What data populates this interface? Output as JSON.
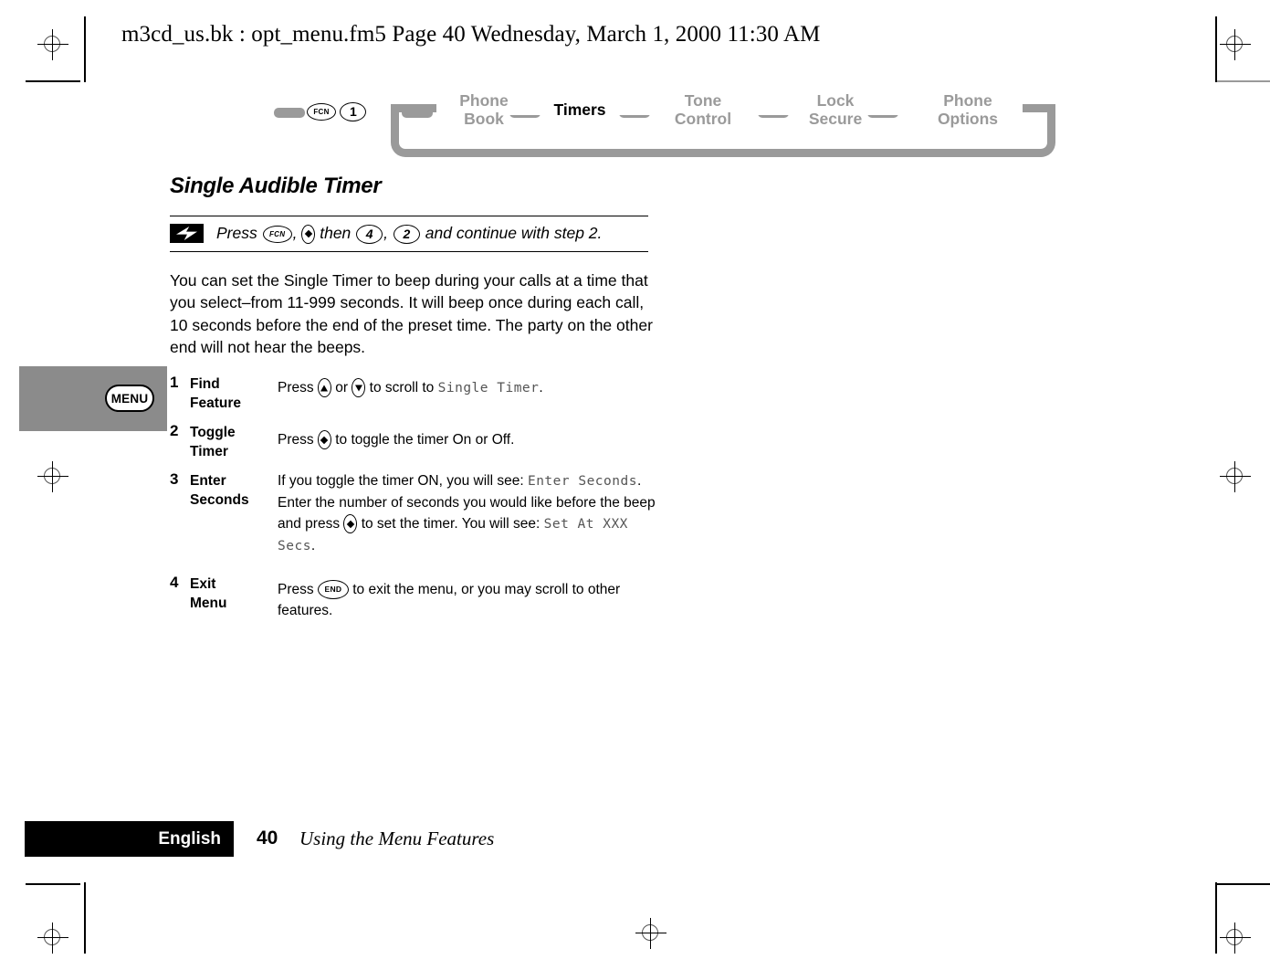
{
  "page_header": "m3cd_us.bk : opt_menu.fm5  Page 40  Wednesday, March 1, 2000  11:30 AM",
  "side_tab": {
    "label": "MENU"
  },
  "nav": {
    "keys": [
      {
        "name": "fcn-key",
        "label": "FCN"
      },
      {
        "name": "one-key",
        "label": "1"
      }
    ],
    "items": [
      {
        "line1": "Phone",
        "line2": "Book",
        "active": false
      },
      {
        "line1": "Timers",
        "line2": "",
        "active": true
      },
      {
        "line1": "Tone",
        "line2": "Control",
        "active": false
      },
      {
        "line1": "Lock",
        "line2": "Secure",
        "active": false
      },
      {
        "line1": "Phone",
        "line2": "Options",
        "active": false
      }
    ]
  },
  "section": {
    "title": "Single Audible Timer",
    "callout": {
      "press_word": "Press",
      "fcn_label": "FCN",
      "then_word": "then",
      "key_4": "4",
      "key_2": "2",
      "comma1": ",",
      "comma2": ",",
      "tail": "and continue with step 2."
    },
    "body": "You can set the Single Timer to beep during your calls at a time that you select–from 11-999 seconds. It will beep once during each call, 10 seconds before the end of the preset time. The party on the other end will not hear the beeps."
  },
  "steps": [
    {
      "number": "1",
      "label_line1": "Find",
      "label_line2": "Feature",
      "desc_part1": "Press",
      "desc_or": "or",
      "desc_part2": "to scroll to",
      "lcd1": "Single Timer",
      "desc_part3": "."
    },
    {
      "number": "2",
      "label_line1": "Toggle",
      "label_line2": "Timer",
      "desc_part1": "Press",
      "desc_part2": "to toggle the timer On or Off."
    },
    {
      "number": "3",
      "label_line1": "Enter",
      "label_line2": "Seconds",
      "desc_part1": "If you toggle the timer ON, you will see:",
      "lcd1": "Enter Seconds",
      "desc_part2": ". Enter the number of seconds you would like before the beep and press",
      "desc_part3": "to set the timer. You will see:",
      "lcd2": "Set At XXX Secs",
      "desc_part4": "."
    },
    {
      "number": "4",
      "label_line1": "Exit",
      "label_line2": "Menu",
      "desc_part1": "Press",
      "end_key": "END",
      "desc_part2": "to exit the menu, or you may scroll to other features."
    }
  ],
  "footer": {
    "language": "English",
    "page_number": "40",
    "section_name": "Using the Menu Features"
  },
  "colors": {
    "nav_gray": "#9a9a9a",
    "tab_gray": "#8b8b8b",
    "lcd_gray": "#555555",
    "footer_black": "#000000"
  }
}
